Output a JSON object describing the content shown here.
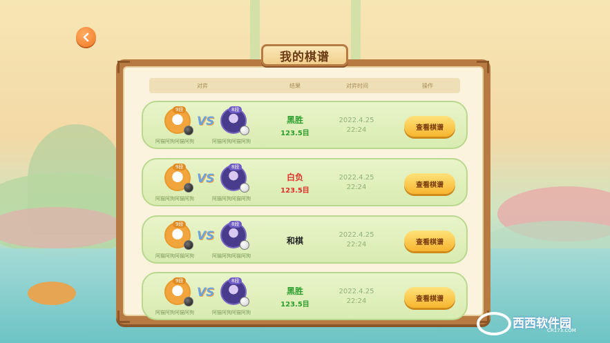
{
  "page": {
    "title": "我的棋谱"
  },
  "header": {
    "col_opponent": "对弈",
    "col_result": "结果",
    "col_time": "对弈时间",
    "col_action": "操作"
  },
  "records": [
    {
      "player1": {
        "dan": "9段",
        "name": "阿猫阿狗阿猫阿狗",
        "stone": "black"
      },
      "player2": {
        "dan": "8段",
        "name": "阿猫阿狗阿猫阿狗",
        "stone": "white"
      },
      "vs": "VS",
      "result_main": "黑胜",
      "result_score": "123.5目",
      "result_color": "#2e9e2e",
      "date": "2022.4.25",
      "time": "22:24",
      "action": "查看棋谱"
    },
    {
      "player1": {
        "dan": "9段",
        "name": "阿猫阿狗阿猫阿狗",
        "stone": "black"
      },
      "player2": {
        "dan": "8段",
        "name": "阿猫阿狗阿猫阿狗",
        "stone": "white"
      },
      "vs": "VS",
      "result_main": "白负",
      "result_score": "123.5目",
      "result_color": "#e0302a",
      "date": "2022.4.25",
      "time": "22:24",
      "action": "查看棋谱"
    },
    {
      "player1": {
        "dan": "9段",
        "name": "阿猫阿狗阿猫阿狗",
        "stone": "black"
      },
      "player2": {
        "dan": "8段",
        "name": "阿猫阿狗阿猫阿狗",
        "stone": "white"
      },
      "vs": "VS",
      "result_main": "和棋",
      "result_score": "",
      "result_color": "#222222",
      "date": "2022.4.25",
      "time": "22:24",
      "action": "查看棋谱"
    },
    {
      "player1": {
        "dan": "9段",
        "name": "阿猫阿狗阿猫阿狗",
        "stone": "black"
      },
      "player2": {
        "dan": "8段",
        "name": "阿猫阿狗阿猫阿狗",
        "stone": "white"
      },
      "vs": "VS",
      "result_main": "黑胜",
      "result_score": "123.5目",
      "result_color": "#2e9e2e",
      "date": "2022.4.25",
      "time": "22:24",
      "action": "查看棋谱"
    }
  ],
  "watermark": {
    "text": "西西软件园",
    "sub": "CR173.COM"
  },
  "icons": {
    "back": "back-arrow-icon"
  }
}
